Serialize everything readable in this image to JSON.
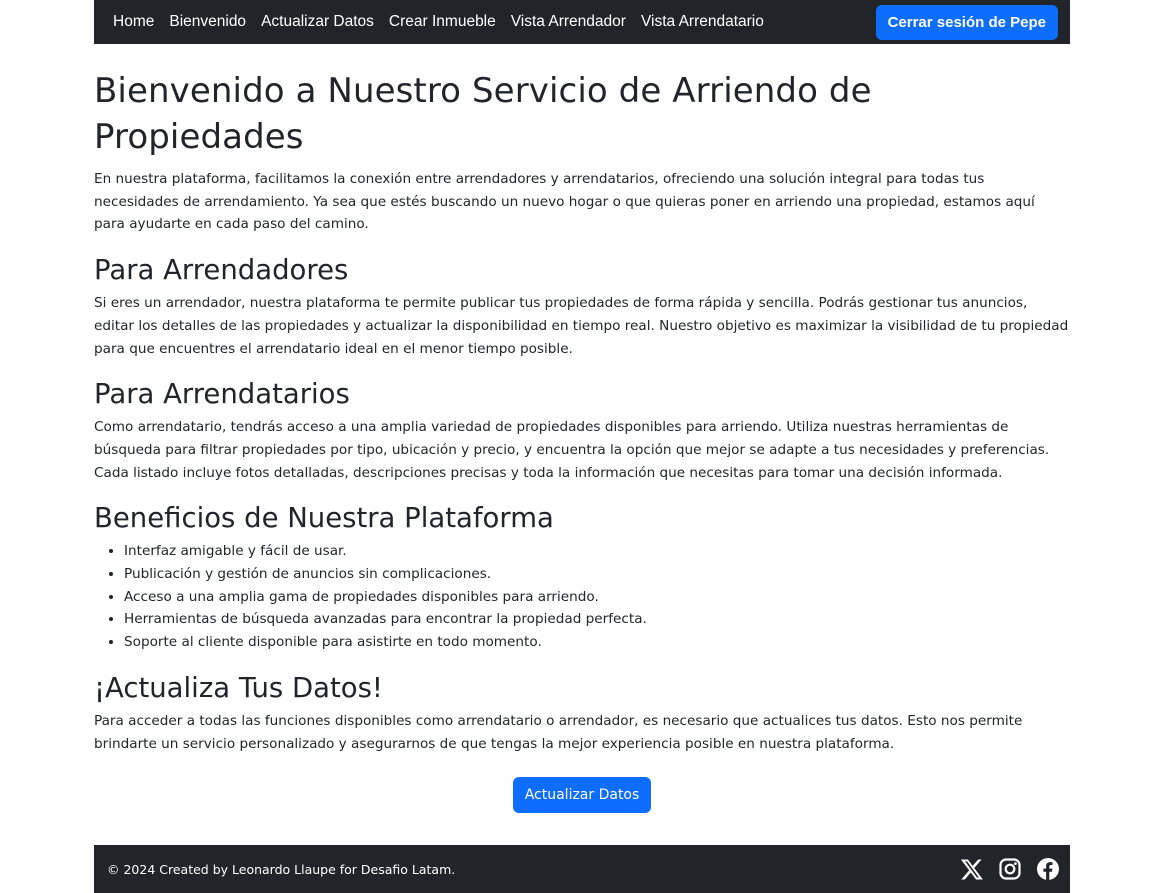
{
  "navbar": {
    "links": [
      "Home",
      "Bienvenido",
      "Actualizar Datos",
      "Crear Inmueble",
      "Vista Arrendador",
      "Vista Arrendatario"
    ],
    "logout_label": "Cerrar sesión de Pepe"
  },
  "main": {
    "title": "Bienvenido a Nuestro Servicio de Arriendo de Propiedades",
    "intro": "En nuestra plataforma, facilitamos la conexión entre arrendadores y arrendatarios, ofreciendo una solución integral para todas tus necesidades de arrendamiento. Ya sea que estés buscando un nuevo hogar o que quieras poner en arriendo una propiedad, estamos aquí para ayudarte en cada paso del camino.",
    "landlords": {
      "heading": "Para Arrendadores",
      "text": "Si eres un arrendador, nuestra plataforma te permite publicar tus propiedades de forma rápida y sencilla. Podrás gestionar tus anuncios, editar los detalles de las propiedades y actualizar la disponibilidad en tiempo real. Nuestro objetivo es maximizar la visibilidad de tu propiedad para que encuentres el arrendatario ideal en el menor tiempo posible."
    },
    "tenants": {
      "heading": "Para Arrendatarios",
      "text": "Como arrendatario, tendrás acceso a una amplia variedad de propiedades disponibles para arriendo. Utiliza nuestras herramientas de búsqueda para filtrar propiedades por tipo, ubicación y precio, y encuentra la opción que mejor se adapte a tus necesidades y preferencias. Cada listado incluye fotos detalladas, descripciones precisas y toda la información que necesitas para tomar una decisión informada."
    },
    "benefits": {
      "heading": "Beneficios de Nuestra Plataforma",
      "items": [
        "Interfaz amigable y fácil de usar.",
        "Publicación y gestión de anuncios sin complicaciones.",
        "Acceso a una amplia gama de propiedades disponibles para arriendo.",
        "Herramientas de búsqueda avanzadas para encontrar la propiedad perfecta.",
        "Soporte al cliente disponible para asistirte en todo momento."
      ]
    },
    "update": {
      "heading": "¡Actualiza Tus Datos!",
      "text": "Para acceder a todas las funciones disponibles como arrendatario o arrendador, es necesario que actualices tus datos. Esto nos permite brindarte un servicio personalizado y asegurarnos de que tengas la mejor experiencia posible en nuestra plataforma.",
      "button_label": "Actualizar Datos"
    }
  },
  "footer": {
    "text": "© 2024 Created by Leonardo Llaupe for Desafio Latam.",
    "social_icons": [
      "x-icon",
      "instagram-icon",
      "facebook-icon"
    ]
  },
  "colors": {
    "primary": "#0d6efd",
    "dark": "#212529",
    "text": "#212529"
  }
}
